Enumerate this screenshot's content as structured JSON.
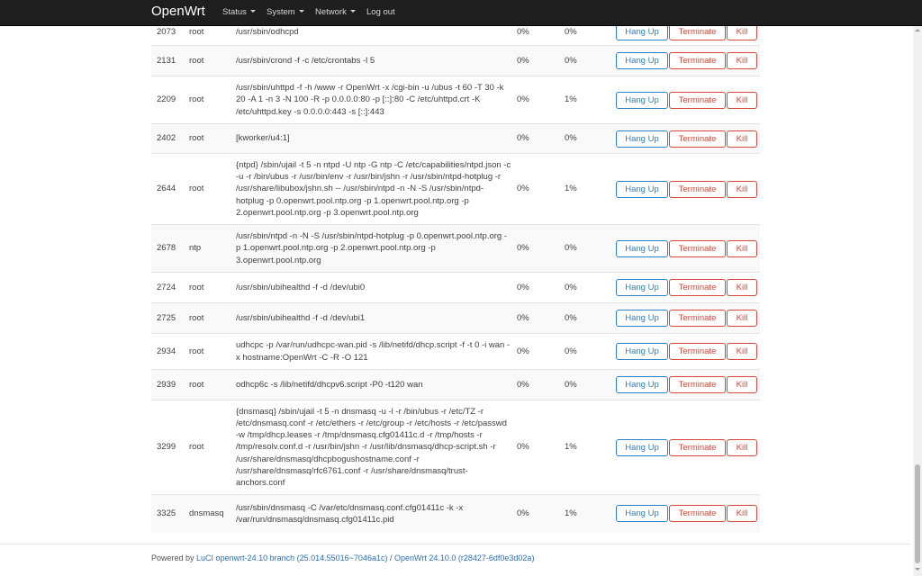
{
  "navbar": {
    "brand": "OpenWrt",
    "menu": [
      {
        "label": "Status"
      },
      {
        "label": "System"
      },
      {
        "label": "Network"
      },
      {
        "label": "Log out"
      }
    ]
  },
  "buttons": {
    "hangup": "Hang Up",
    "terminate": "Terminate",
    "kill": "Kill"
  },
  "processes": [
    {
      "pid": "2073",
      "owner": "root",
      "command": "/usr/sbin/odhcpd",
      "cpu": "0%",
      "mem": "0%"
    },
    {
      "pid": "2131",
      "owner": "root",
      "command": "/usr/sbin/crond -f -c /etc/crontabs -l 5",
      "cpu": "0%",
      "mem": "0%"
    },
    {
      "pid": "2209",
      "owner": "root",
      "command": "/usr/sbin/uhttpd -f -h /www -r OpenWrt -x /cgi-bin -u /ubus -t 60 -T 30 -k 20 -A 1 -n 3 -N 100 -R -p 0.0.0.0:80 -p [::]:80 -C /etc/uhttpd.crt -K /etc/uhttpd.key -s 0.0.0.0:443 -s [::]:443",
      "cpu": "0%",
      "mem": "1%"
    },
    {
      "pid": "2402",
      "owner": "root",
      "command": "[kworker/u4:1]",
      "cpu": "0%",
      "mem": "0%"
    },
    {
      "pid": "2644",
      "owner": "root",
      "command": "{ntpd} /sbin/ujail -t 5 -n ntpd -U ntp -G ntp -C /etc/capabilities/ntpd.json -c -u -r /bin/ubus -r /usr/bin/env -r /usr/bin/jshn -r /usr/sbin/ntpd-hotplug -r /usr/share/libubox/jshn.sh -- /usr/sbin/ntpd -n -N -S /usr/sbin/ntpd-hotplug -p 0.openwrt.pool.ntp.org -p 1.openwrt.pool.ntp.org -p 2.openwrt.pool.ntp.org -p 3.openwrt.pool.ntp.org",
      "cpu": "0%",
      "mem": "1%"
    },
    {
      "pid": "2678",
      "owner": "ntp",
      "command": "/usr/sbin/ntpd -n -N -S /usr/sbin/ntpd-hotplug -p 0.openwrt.pool.ntp.org -p 1.openwrt.pool.ntp.org -p 2.openwrt.pool.ntp.org -p 3.openwrt.pool.ntp.org",
      "cpu": "0%",
      "mem": "0%"
    },
    {
      "pid": "2724",
      "owner": "root",
      "command": "/usr/sbin/ubihealthd -f -d /dev/ubi0",
      "cpu": "0%",
      "mem": "0%"
    },
    {
      "pid": "2725",
      "owner": "root",
      "command": "/usr/sbin/ubihealthd -f -d /dev/ubi1",
      "cpu": "0%",
      "mem": "0%"
    },
    {
      "pid": "2934",
      "owner": "root",
      "command": "udhcpc -p /var/run/udhcpc-wan.pid -s /lib/netifd/dhcp.script -f -t 0 -i wan -x hostname:OpenWrt -C -R -O 121",
      "cpu": "0%",
      "mem": "0%"
    },
    {
      "pid": "2939",
      "owner": "root",
      "command": "odhcp6c -s /lib/netifd/dhcpv6.script -P0 -t120 wan",
      "cpu": "0%",
      "mem": "0%"
    },
    {
      "pid": "3299",
      "owner": "root",
      "command": "{dnsmasq} /sbin/ujail -t 5 -n dnsmasq -u -l -r /bin/ubus -r /etc/TZ -r /etc/dnsmasq.conf -r /etc/ethers -r /etc/group -r /etc/hosts -r /etc/passwd -w /tmp/dhcp.leases -r /tmp/dnsmasq.cfg01411c.d -r /tmp/hosts -r /tmp/resolv.conf.d -r /usr/bin/jshn -r /usr/lib/dnsmasq/dhcp-script.sh -r /usr/share/dnsmasq/dhcpbogushostname.conf -r /usr/share/dnsmasq/rfc6761.conf -r /usr/share/dnsmasq/trust-anchors.conf",
      "cpu": "0%",
      "mem": "1%"
    },
    {
      "pid": "3325",
      "owner": "dnsmasq",
      "command": "/usr/sbin/dnsmasq -C /var/etc/dnsmasq.conf.cfg01411c -k -x /var/run/dnsmasq/dnsmasq.cfg01411c.pid",
      "cpu": "0%",
      "mem": "1%"
    }
  ],
  "footer": {
    "powered_by": "Powered by",
    "luci_link": "LuCI openwrt-24.10 branch (25.014.55016~7046a1c)",
    "separator": "/",
    "openwrt_link": "OpenWrt 24.10.0 (r28427-6df0e3d02a)"
  },
  "colors": {
    "navbar_bg": "#1e1e1e",
    "link": "#2b6fbf",
    "hangup": "#2b82c8",
    "danger": "#d9473b"
  }
}
